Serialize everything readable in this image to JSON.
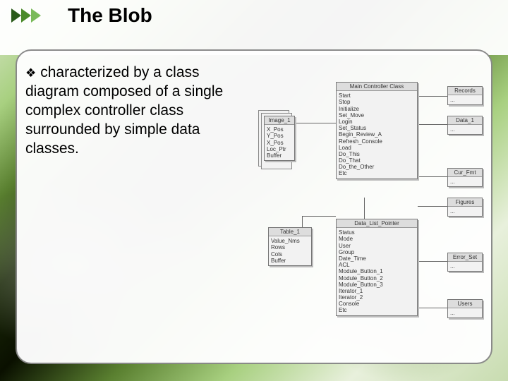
{
  "title": "The Blob",
  "bullet": "characterized by a class diagram composed of a single complex controller class surrounded by simple data classes.",
  "uml": {
    "controller": {
      "name": "Main Controller Class",
      "ops": [
        "Start",
        "Stop",
        "Initialize",
        "Set_Move",
        "Login",
        "Set_Status",
        "Begin_Review_A",
        "Refresh_Console",
        "Load",
        "Do_This",
        "Do_That",
        "Do_the_Other",
        "Etc"
      ]
    },
    "image": {
      "name": "Image_1",
      "fields": [
        "X_Pos",
        "Y_Pos",
        "X_Pos",
        "Loc_Ptr",
        "Buffer"
      ]
    },
    "table": {
      "name": "Table_1",
      "fields": [
        "Value_Nms",
        "Rows",
        "Cols",
        "Buffer"
      ]
    },
    "pointer": {
      "name": "Data_List_Pointer",
      "fields": [
        "Status",
        "Mode",
        "User",
        "Group",
        "Date_Time",
        "ACL",
        "Module_Button_1",
        "Module_Button_2",
        "Module_Button_3",
        "Iterator_1",
        "Iterator_2",
        "Console",
        "Etc"
      ]
    },
    "side": {
      "records": "Records",
      "data": "Data_1",
      "curfmt": "Cur_Fmt",
      "figures": "Figures",
      "errorset": "Error_Set",
      "users": "Users"
    },
    "etc": "..."
  }
}
